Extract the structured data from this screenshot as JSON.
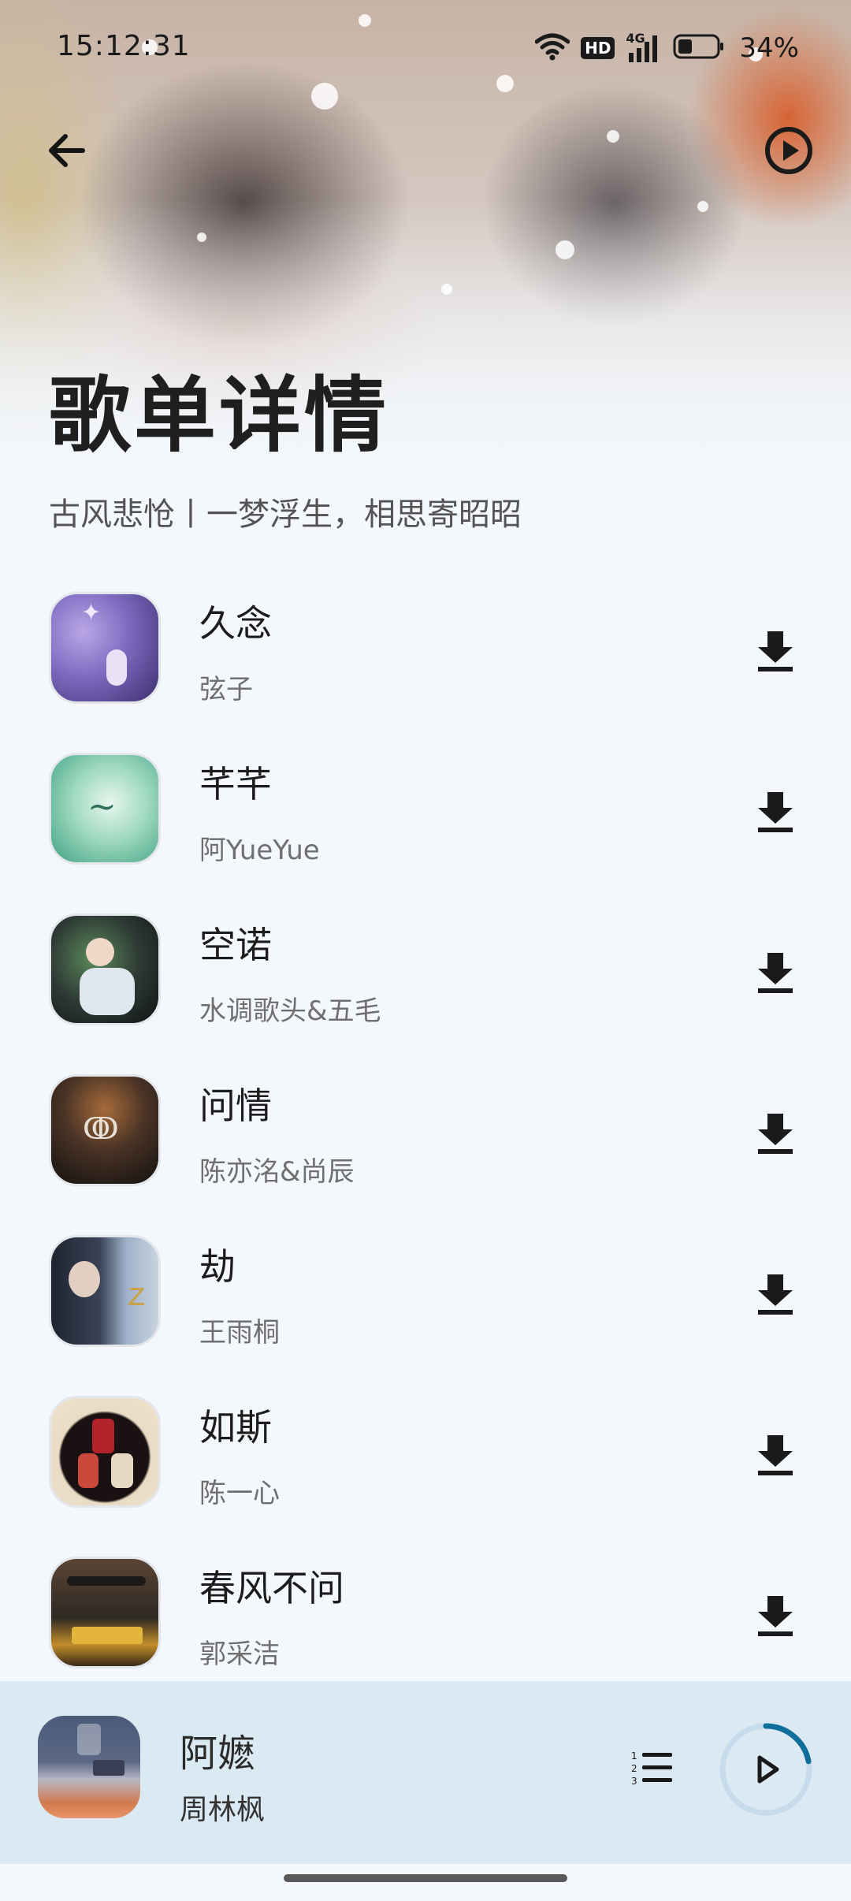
{
  "status": {
    "time": "15:12:31",
    "network_badge": "HD",
    "signal_label": "4G",
    "battery": "34%"
  },
  "icons": {
    "back": "arrow-left-icon",
    "play_all": "play-circle-icon",
    "download": "download-icon",
    "queue": "playlist-icon",
    "mini_play": "play-icon"
  },
  "header": {
    "title": "歌单详情",
    "subtitle": "古风悲怆丨一梦浮生，相思寄昭昭"
  },
  "songs": [
    {
      "title": "久念",
      "artist": "弦子"
    },
    {
      "title": "芊芊",
      "artist": "阿YueYue"
    },
    {
      "title": "空诺",
      "artist": "水调歌头&五毛"
    },
    {
      "title": "问情",
      "artist": "陈亦洺&尚辰"
    },
    {
      "title": "劫",
      "artist": "王雨桐"
    },
    {
      "title": "如斯",
      "artist": "陈一心"
    },
    {
      "title": "春风不问",
      "artist": "郭采洁"
    }
  ],
  "now_playing": {
    "title": "阿嬷",
    "artist": "周林枫",
    "progress": 0.22
  },
  "colors": {
    "accent": "#0f6e9a",
    "player_bg": "#dbe9f2",
    "list_bg": "#f4f8fc"
  }
}
